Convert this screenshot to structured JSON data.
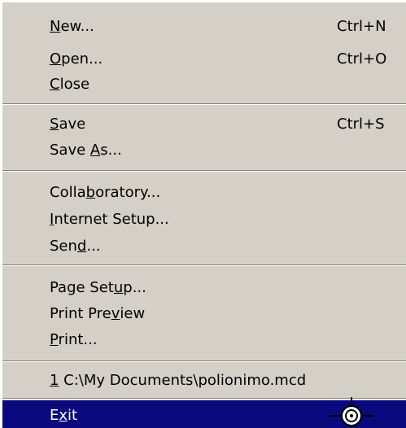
{
  "menu": {
    "items": [
      {
        "id": "new",
        "before": "",
        "key": "N",
        "after": "ew...",
        "shortcut": "Ctrl+N"
      },
      {
        "id": "open",
        "before": "",
        "key": "O",
        "after": "pen...",
        "shortcut": "Ctrl+O"
      },
      {
        "id": "close",
        "before": "",
        "key": "C",
        "after": "lose",
        "shortcut": ""
      },
      {
        "id": "save",
        "before": "",
        "key": "S",
        "after": "ave",
        "shortcut": "Ctrl+S"
      },
      {
        "id": "save-as",
        "before": "Save ",
        "key": "A",
        "after": "s...",
        "shortcut": ""
      },
      {
        "id": "collaboratory",
        "before": "Colla",
        "key": "b",
        "after": "oratory...",
        "shortcut": ""
      },
      {
        "id": "internet-setup",
        "before": "",
        "key": "I",
        "after": "nternet Setup...",
        "shortcut": ""
      },
      {
        "id": "send",
        "before": "Sen",
        "key": "d",
        "after": "...",
        "shortcut": ""
      },
      {
        "id": "page-setup",
        "before": "Page Set",
        "key": "u",
        "after": "p...",
        "shortcut": ""
      },
      {
        "id": "print-preview",
        "before": "Print Pre",
        "key": "v",
        "after": "iew",
        "shortcut": ""
      },
      {
        "id": "print",
        "before": "",
        "key": "P",
        "after": "rint...",
        "shortcut": ""
      },
      {
        "id": "recent-file-1",
        "before": "",
        "key": "1",
        "after": " C:\\My Documents\\polionimo.mcd",
        "shortcut": ""
      },
      {
        "id": "exit",
        "before": "E",
        "key": "x",
        "after": "it",
        "shortcut": ""
      }
    ],
    "highlighted_item": "Exit",
    "highlight_color": "#0a0a7e",
    "background_color": "#d4d0c8"
  }
}
